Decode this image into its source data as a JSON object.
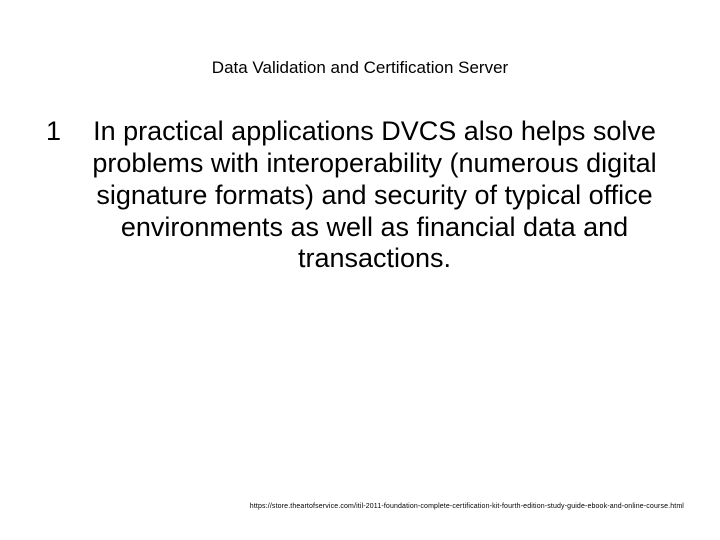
{
  "slide": {
    "title": "Data Validation and Certification Server",
    "bullet_marker": "1",
    "body": "In practical applications DVCS also helps solve problems with interoperability (numerous digital signature formats) and security of typical office environments as well as financial data and transactions.",
    "footer_url": "https://store.theartofservice.com/itil-2011-foundation-complete-certification-kit-fourth-edition-study-guide-ebook-and-online-course.html"
  }
}
